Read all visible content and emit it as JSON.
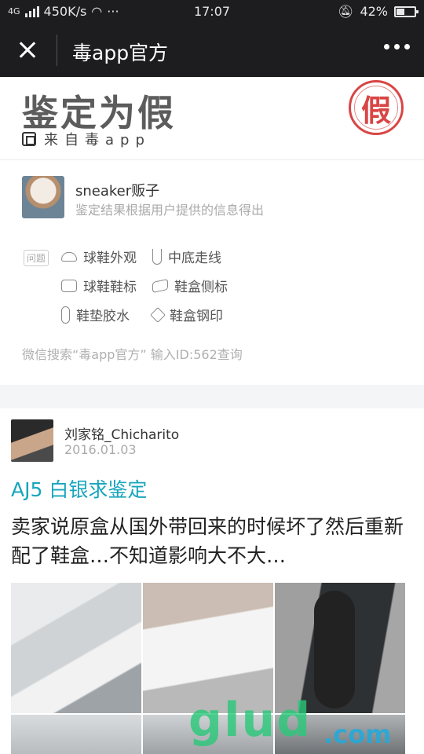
{
  "status_bar": {
    "network": "4G",
    "speed": "450K/s",
    "time": "17:07",
    "battery": "42%"
  },
  "nav": {
    "title": "毒app官方"
  },
  "verdict": {
    "title": "鉴定为假",
    "source": "来自毒app",
    "stamp": "假",
    "stamp_color": "#d94545"
  },
  "user": {
    "name": "sneaker贩子",
    "subtitle": "鉴定结果根据用户提供的信息得出"
  },
  "issues": {
    "tag": "问题",
    "items": [
      {
        "label": "球鞋外观",
        "icon": "shoe-icon"
      },
      {
        "label": "中底走线",
        "icon": "stitch-icon"
      },
      {
        "label": "球鞋鞋标",
        "icon": "label-icon"
      },
      {
        "label": "鞋盒侧标",
        "icon": "box-icon"
      },
      {
        "label": "鞋垫胶水",
        "icon": "insole-icon"
      },
      {
        "label": "鞋盒钢印",
        "icon": "tag-icon"
      }
    ]
  },
  "search_tip": "微信搜索“毒app官方” 输入ID:562查询",
  "post": {
    "author": "刘家铭_Chicharito",
    "date": "2016.01.03",
    "title": "AJ5 白银求鉴定",
    "title_color": "#18a5bd",
    "body": "卖家说原盒从国外带回来的时候坏了然后重新配了鞋盒…不知道影响大不大…"
  },
  "watermark": {
    "main": "glud",
    "sub": ".com"
  }
}
